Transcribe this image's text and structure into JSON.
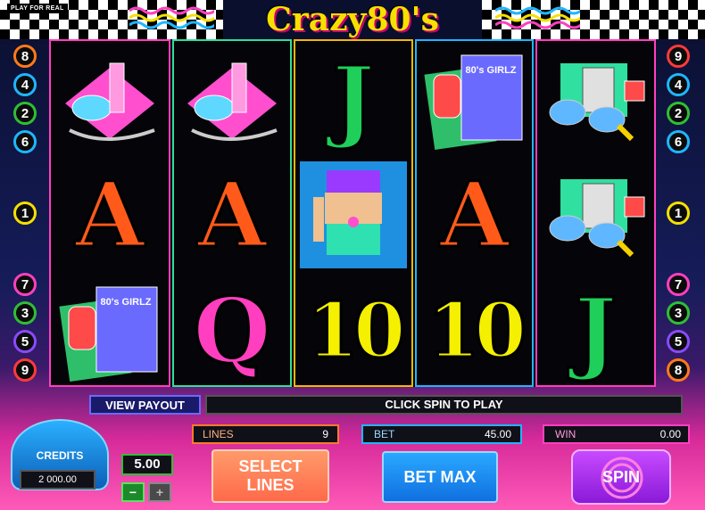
{
  "header": {
    "play_mode": "PLAY FOR REAL",
    "logo_text": "Crazy80's"
  },
  "paylines": {
    "left_top": [
      "8",
      "4",
      "2",
      "6"
    ],
    "left_mid": [
      "1"
    ],
    "left_bottom": [
      "7",
      "3",
      "5",
      "9"
    ],
    "right_top": [
      "9",
      "4",
      "2",
      "6"
    ],
    "right_mid": [
      "1"
    ],
    "right_bottom": [
      "7",
      "3",
      "5",
      "8"
    ]
  },
  "reels": [
    {
      "border": "#ff3fbf",
      "symbols": [
        {
          "kind": "perfume-icon"
        },
        {
          "kind": "card",
          "text": "A",
          "color": "#ff5a1a"
        },
        {
          "kind": "magazine-phone-icon",
          "label": "80's GIRLZ"
        }
      ]
    },
    {
      "border": "#2fdf9a",
      "symbols": [
        {
          "kind": "perfume-icon"
        },
        {
          "kind": "card",
          "text": "A",
          "color": "#ff5a1a"
        },
        {
          "kind": "card",
          "text": "Q",
          "color": "#ff3fbf"
        }
      ]
    },
    {
      "border": "#f5b800",
      "symbols": [
        {
          "kind": "card",
          "text": "J",
          "color": "#1fcf5a"
        },
        {
          "kind": "dancer-icon"
        },
        {
          "kind": "card",
          "text": "10",
          "color": "#f5f000"
        }
      ]
    },
    {
      "border": "#1fb6ff",
      "symbols": [
        {
          "kind": "magazine-phone-icon",
          "label": "80's GIRLZ"
        },
        {
          "kind": "card",
          "text": "A",
          "color": "#ff5a1a"
        },
        {
          "kind": "card",
          "text": "10",
          "color": "#f5f000"
        }
      ]
    },
    {
      "border": "#ff3fbf",
      "symbols": [
        {
          "kind": "sunglasses-cassette-icon"
        },
        {
          "kind": "sunglasses-cassette-icon"
        },
        {
          "kind": "card",
          "text": "J",
          "color": "#1fcf5a"
        }
      ]
    }
  ],
  "controls": {
    "view_payout": "VIEW PAYOUT",
    "status_message": "CLICK SPIN TO PLAY",
    "lines_label": "LINES",
    "lines_value": "9",
    "bet_label": "BET",
    "bet_value": "45.00",
    "win_label": "WIN",
    "win_value": "0.00",
    "credits_label": "CREDITS",
    "credits_value": "2 000.00",
    "coin_value": "5.00",
    "minus": "−",
    "plus": "+",
    "select_lines_1": "SELECT",
    "select_lines_2": "LINES",
    "bet_max": "BET MAX",
    "spin": "SPIN"
  }
}
